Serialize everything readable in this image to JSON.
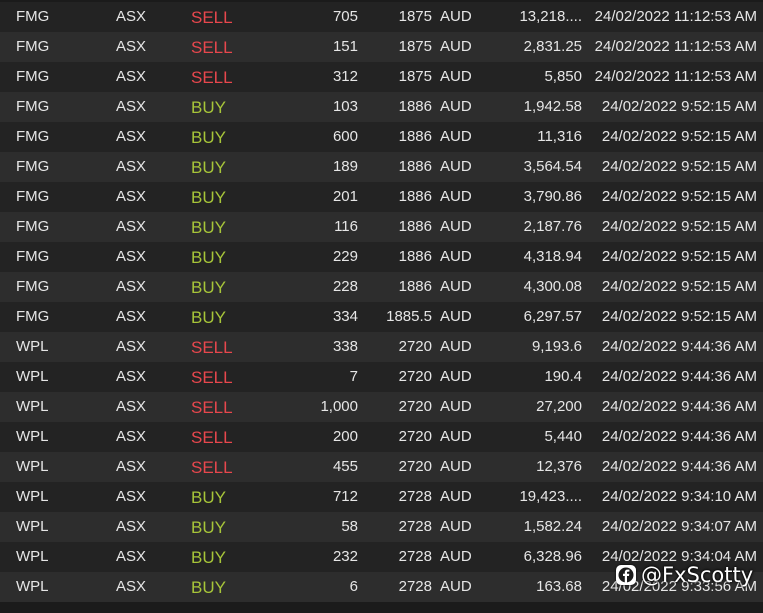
{
  "rows": [
    {
      "symbol": "FMG",
      "exchange": "ASX",
      "side": "SELL",
      "quantity": "705",
      "price": "1875",
      "currency": "AUD",
      "value": "13,218....",
      "time": "24/02/2022 11:12:53 AM"
    },
    {
      "symbol": "FMG",
      "exchange": "ASX",
      "side": "SELL",
      "quantity": "151",
      "price": "1875",
      "currency": "AUD",
      "value": "2,831.25",
      "time": "24/02/2022 11:12:53 AM"
    },
    {
      "symbol": "FMG",
      "exchange": "ASX",
      "side": "SELL",
      "quantity": "312",
      "price": "1875",
      "currency": "AUD",
      "value": "5,850",
      "time": "24/02/2022 11:12:53 AM"
    },
    {
      "symbol": "FMG",
      "exchange": "ASX",
      "side": "BUY",
      "quantity": "103",
      "price": "1886",
      "currency": "AUD",
      "value": "1,942.58",
      "time": "24/02/2022 9:52:15 AM"
    },
    {
      "symbol": "FMG",
      "exchange": "ASX",
      "side": "BUY",
      "quantity": "600",
      "price": "1886",
      "currency": "AUD",
      "value": "11,316",
      "time": "24/02/2022 9:52:15 AM"
    },
    {
      "symbol": "FMG",
      "exchange": "ASX",
      "side": "BUY",
      "quantity": "189",
      "price": "1886",
      "currency": "AUD",
      "value": "3,564.54",
      "time": "24/02/2022 9:52:15 AM"
    },
    {
      "symbol": "FMG",
      "exchange": "ASX",
      "side": "BUY",
      "quantity": "201",
      "price": "1886",
      "currency": "AUD",
      "value": "3,790.86",
      "time": "24/02/2022 9:52:15 AM"
    },
    {
      "symbol": "FMG",
      "exchange": "ASX",
      "side": "BUY",
      "quantity": "116",
      "price": "1886",
      "currency": "AUD",
      "value": "2,187.76",
      "time": "24/02/2022 9:52:15 AM"
    },
    {
      "symbol": "FMG",
      "exchange": "ASX",
      "side": "BUY",
      "quantity": "229",
      "price": "1886",
      "currency": "AUD",
      "value": "4,318.94",
      "time": "24/02/2022 9:52:15 AM"
    },
    {
      "symbol": "FMG",
      "exchange": "ASX",
      "side": "BUY",
      "quantity": "228",
      "price": "1886",
      "currency": "AUD",
      "value": "4,300.08",
      "time": "24/02/2022 9:52:15 AM"
    },
    {
      "symbol": "FMG",
      "exchange": "ASX",
      "side": "BUY",
      "quantity": "334",
      "price": "1885.5",
      "currency": "AUD",
      "value": "6,297.57",
      "time": "24/02/2022 9:52:15 AM"
    },
    {
      "symbol": "WPL",
      "exchange": "ASX",
      "side": "SELL",
      "quantity": "338",
      "price": "2720",
      "currency": "AUD",
      "value": "9,193.6",
      "time": "24/02/2022 9:44:36 AM"
    },
    {
      "symbol": "WPL",
      "exchange": "ASX",
      "side": "SELL",
      "quantity": "7",
      "price": "2720",
      "currency": "AUD",
      "value": "190.4",
      "time": "24/02/2022 9:44:36 AM"
    },
    {
      "symbol": "WPL",
      "exchange": "ASX",
      "side": "SELL",
      "quantity": "1,000",
      "price": "2720",
      "currency": "AUD",
      "value": "27,200",
      "time": "24/02/2022 9:44:36 AM"
    },
    {
      "symbol": "WPL",
      "exchange": "ASX",
      "side": "SELL",
      "quantity": "200",
      "price": "2720",
      "currency": "AUD",
      "value": "5,440",
      "time": "24/02/2022 9:44:36 AM"
    },
    {
      "symbol": "WPL",
      "exchange": "ASX",
      "side": "SELL",
      "quantity": "455",
      "price": "2720",
      "currency": "AUD",
      "value": "12,376",
      "time": "24/02/2022 9:44:36 AM"
    },
    {
      "symbol": "WPL",
      "exchange": "ASX",
      "side": "BUY",
      "quantity": "712",
      "price": "2728",
      "currency": "AUD",
      "value": "19,423....",
      "time": "24/02/2022 9:34:10 AM"
    },
    {
      "symbol": "WPL",
      "exchange": "ASX",
      "side": "BUY",
      "quantity": "58",
      "price": "2728",
      "currency": "AUD",
      "value": "1,582.24",
      "time": "24/02/2022 9:34:07 AM"
    },
    {
      "symbol": "WPL",
      "exchange": "ASX",
      "side": "BUY",
      "quantity": "232",
      "price": "2728",
      "currency": "AUD",
      "value": "6,328.96",
      "time": "24/02/2022 9:34:04 AM"
    },
    {
      "symbol": "WPL",
      "exchange": "ASX",
      "side": "BUY",
      "quantity": "6",
      "price": "2728",
      "currency": "AUD",
      "value": "163.68",
      "time": "24/02/2022 9:33:56 AM"
    }
  ],
  "watermark": {
    "icon": "facebook-icon",
    "handle": "@FxScotty"
  },
  "colors": {
    "sell": "#e8474d",
    "buy": "#a7c539",
    "row_dark": "#232323",
    "row_light": "#2d2d2d",
    "text": "#e6e6e6"
  }
}
